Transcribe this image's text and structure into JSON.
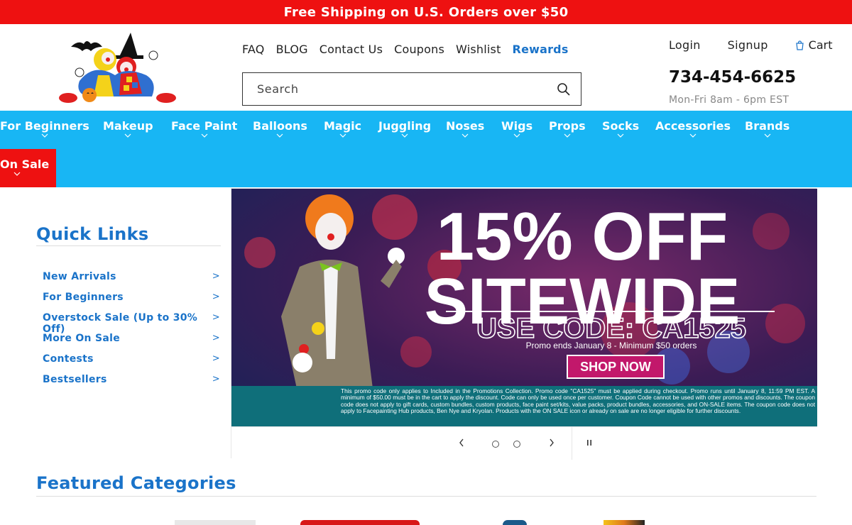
{
  "announcement": "Free Shipping on U.S. Orders over $50",
  "top_links": [
    {
      "label": "FAQ"
    },
    {
      "label": "BLOG"
    },
    {
      "label": "Contact Us"
    },
    {
      "label": "Coupons"
    },
    {
      "label": "Wishlist"
    },
    {
      "label": "Rewards"
    }
  ],
  "search": {
    "placeholder": "Search"
  },
  "account": {
    "login": "Login",
    "signup": "Signup",
    "cart": "Cart"
  },
  "phone": "734-454-6625",
  "hours": "Mon-Fri 8am - 6pm EST",
  "nav": {
    "items": [
      "For Beginners",
      "Makeup",
      "Face Paint",
      "Balloons",
      "Magic",
      "Juggling",
      "Noses",
      "Wigs",
      "Props",
      "Socks",
      "Accessories",
      "Brands"
    ],
    "sale": "On Sale"
  },
  "quick_links": {
    "title": "Quick Links",
    "items": [
      "New Arrivals",
      "For Beginners",
      "Overstock Sale (Up to 30% Off)",
      "More On Sale",
      "Contests",
      "Bestsellers"
    ],
    "arrow": ">"
  },
  "banner": {
    "headline_1": "15% OFF",
    "headline_2": "SITEWIDE",
    "code_line": "USE CODE: CA1525",
    "promo_line": "Promo ends January 8 - Minimum $50 orders",
    "cta": "SHOP NOW",
    "fine_print": "This promo code only applies to Included in the Promotions Collection. Promo code \"CA1525\" must be applied during checkout. Promo runs until January 8, 11:59 PM EST. A minimum of $50.00 must be in the cart to apply the discount. Code can only be used once per customer. Coupon Code cannot be used with other promos and discounts. The coupon code does not apply to gift cards, custom bundles, custom products, face paint set/kits, value packs, product bundles, accessories, and ON-SALE items. The coupon code does not apply to Facepainting Hub products, Ben Nye and Kryolan. Products with the ON SALE icon or already on sale are no longer eligible for further discounts."
  },
  "slider": {
    "slide_count": 2,
    "active_slide": 1
  },
  "featured": {
    "title": "Featured Categories"
  },
  "colors": {
    "announcement_bg": "#ee1111",
    "nav_bg": "#18b6f4",
    "sale_bg": "#ee1111",
    "link_blue": "#1a73c9",
    "banner_cta": "#c2186b",
    "banner_footer": "#0f6f7a"
  },
  "icons": [
    "search-icon",
    "cart-icon",
    "chevron-down-icon",
    "chevron-left-icon",
    "chevron-right-icon",
    "pause-icon"
  ]
}
